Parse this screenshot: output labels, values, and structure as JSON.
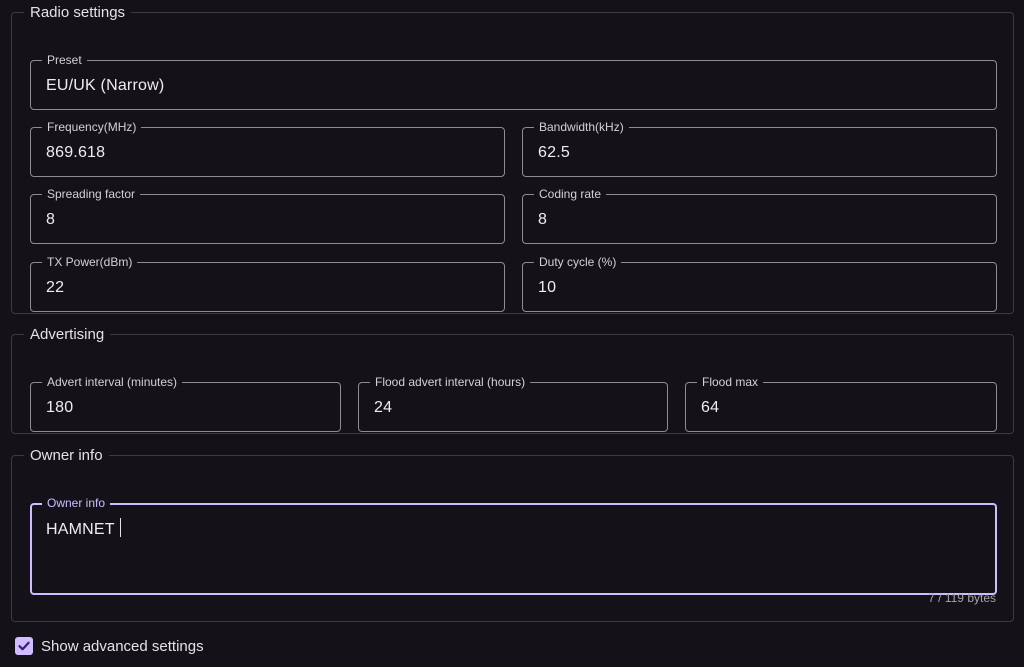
{
  "radio_settings": {
    "title": "Radio settings",
    "preset": {
      "label": "Preset",
      "value": "EU/UK (Narrow)"
    },
    "frequency": {
      "label": "Frequency(MHz)",
      "value": "869.618"
    },
    "bandwidth": {
      "label": "Bandwidth(kHz)",
      "value": "62.5"
    },
    "spreading_factor": {
      "label": "Spreading factor",
      "value": "8"
    },
    "coding_rate": {
      "label": "Coding rate",
      "value": "8"
    },
    "tx_power": {
      "label": "TX Power(dBm)",
      "value": "22"
    },
    "duty_cycle": {
      "label": "Duty cycle (%)",
      "value": "10"
    }
  },
  "advertising": {
    "title": "Advertising",
    "advert_interval": {
      "label": "Advert interval (minutes)",
      "value": "180"
    },
    "flood_advert_interval": {
      "label": "Flood advert interval (hours)",
      "value": "24"
    },
    "flood_max": {
      "label": "Flood max",
      "value": "64"
    }
  },
  "owner_info": {
    "title": "Owner info",
    "field": {
      "label": "Owner info",
      "value": "HAMNET"
    },
    "helper": "7 / 119 bytes"
  },
  "advanced": {
    "label": "Show advanced settings",
    "checked": true
  },
  "colors": {
    "background": "#141218",
    "accent": "#d0bcff",
    "border": "#8f8b93"
  }
}
